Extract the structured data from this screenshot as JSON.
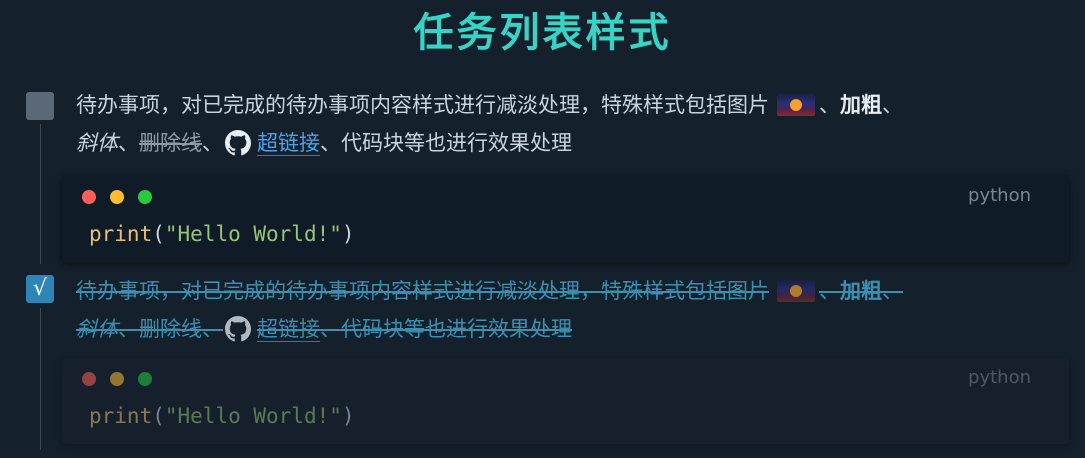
{
  "page": {
    "title": "任务列表样式"
  },
  "tasks": [
    {
      "checked": false,
      "text_part1": "待办事项，对已完成的待办事项内容样式进行减淡处理，特殊样式包括图片",
      "sep1": "、",
      "bold": "加粗",
      "sep2": "、",
      "italic": "斜体",
      "sep3": "、",
      "strike": "删除线",
      "sep4": "、",
      "link": "超链接",
      "text_part2": "、代码块等也进行效果处理",
      "code": {
        "lang": "python",
        "fn": "print",
        "open": "(",
        "str": "\"Hello World!\"",
        "close": ")"
      }
    },
    {
      "checked": true,
      "checkmark": "√",
      "text_part1": "待办事项，对已完成的待办事项内容样式进行减淡处理，特殊样式包括图片",
      "sep1": "、",
      "bold": "加粗",
      "sep2": "、",
      "italic": "斜体",
      "sep3": "、",
      "strike": "删除线",
      "sep4": "、",
      "link": "超链接",
      "text_part2": "、代码块等也进行效果处理",
      "code": {
        "lang": "python",
        "fn": "print",
        "open": "(",
        "str": "\"Hello World!\"",
        "close": ")"
      }
    }
  ],
  "colors": {
    "background": "#14202c",
    "title": "#37d3c4",
    "link": "#4aa3e8",
    "checked": "#2e86b8",
    "dot_red": "#ff5f56",
    "dot_yellow": "#ffbd2e",
    "dot_green": "#27c93f"
  },
  "icons": {
    "image": "sunset-image-thumbnail",
    "link": "github-icon"
  }
}
